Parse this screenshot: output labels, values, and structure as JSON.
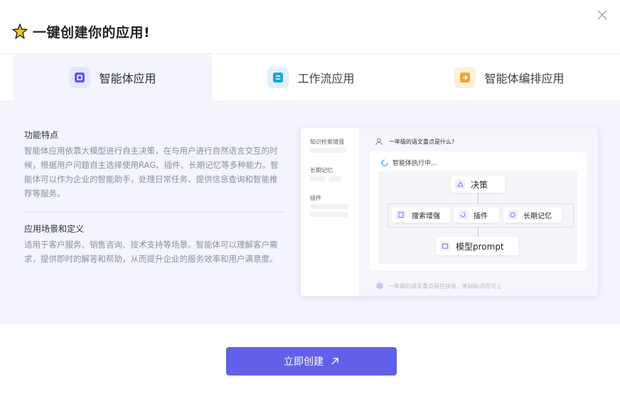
{
  "header": {
    "title": "一键创建你的应用!"
  },
  "tabs": [
    {
      "label": "智能体应用",
      "icon": "agent-app-icon",
      "active": true,
      "color": "#5b57e6"
    },
    {
      "label": "工作流应用",
      "icon": "workflow-app-icon",
      "active": false,
      "color": "#1da1e6"
    },
    {
      "label": "智能体编排应用",
      "icon": "agent-orchestration-icon",
      "active": false,
      "color": "#f2a42d"
    }
  ],
  "features": {
    "title": "功能特点",
    "body": "智能体应用依靠大模型进行自主决策，在与用户进行自然语言交互的时候，根据用户问题自主选择使用RAG、插件、长期记忆等多种能力。智能体可以作为企业的智能助手，处理日常任务、提供信息查询和智能推荐等服务。"
  },
  "scenarios": {
    "title": "应用场景和定义",
    "body": "适用于客户服务、销售咨询、技术支持等场景。智能体可以理解客户需求，提供即时的解答和帮助，从而提升企业的服务效率和用户满意度。"
  },
  "preview": {
    "sidebar": [
      "知识检索增强",
      "长期记忆",
      "插件"
    ],
    "question": "一年级的语文重点是什么?",
    "status": "智能体执行中...",
    "nodes": {
      "decision": "决策",
      "search": "搜索增强",
      "plugin": "插件",
      "memory": "长期记忆",
      "model": "模型prompt"
    },
    "input_placeholder": "一年级的语文重点是在拼音、基础标点符号上"
  },
  "cta": {
    "label": "立即创建"
  },
  "colors": {
    "accent": "#6260e8",
    "panel_bg": "#f4f4fd"
  }
}
